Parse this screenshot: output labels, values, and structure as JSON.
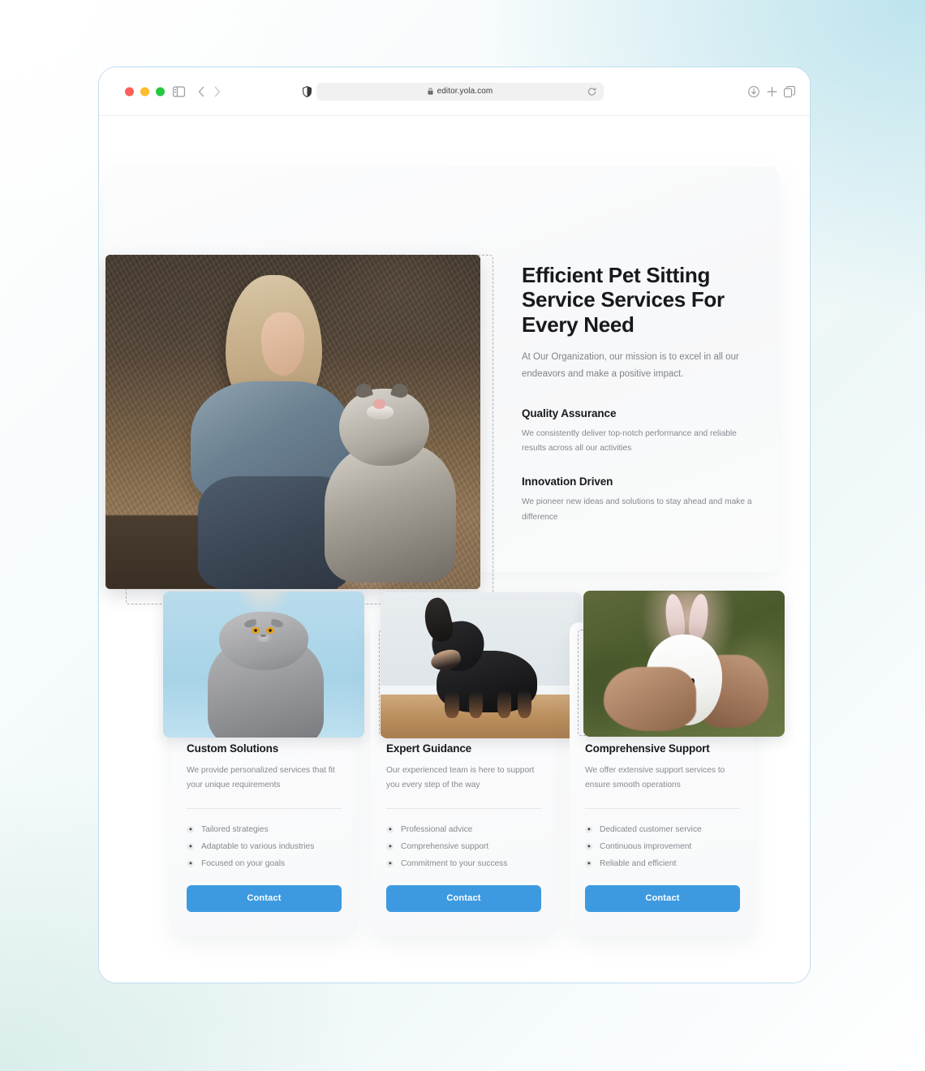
{
  "browser": {
    "url": "editor.yola.com",
    "lock_icon": "lock-icon",
    "reload_icon": "reload-icon",
    "sidebar_icon": "sidebar-toggle-icon",
    "back_icon": "back-chevron-icon",
    "forward_icon": "forward-chevron-icon",
    "shield_icon": "privacy-shield-icon",
    "download_icon": "download-icon",
    "new_tab_icon": "plus-icon",
    "tabs_icon": "tab-overview-icon",
    "traffic_lights": [
      "close",
      "minimize",
      "maximize"
    ]
  },
  "hero": {
    "title": "Efficient Pet Sitting Service Services For Every Need",
    "subtitle": "At Our Organization, our mission is to excel in all our endeavors and make a positive impact.",
    "image_alt": "woman-sitting-with-dog-photo",
    "features": [
      {
        "title": "Quality Assurance",
        "body": "We consistently deliver top-notch performance and reliable results across all our activities"
      },
      {
        "title": "Innovation Driven",
        "body": "We pioneer new ideas and solutions to stay ahead and make a difference"
      }
    ]
  },
  "cards": [
    {
      "image_alt": "grey-cat-photo",
      "title": "Custom Solutions",
      "description": "We provide personalized services that fit your unique requirements",
      "items": [
        "Tailored strategies",
        "Adaptable to various industries",
        "Focused on your goals"
      ],
      "button": "Contact"
    },
    {
      "image_alt": "black-dachshund-photo",
      "title": "Expert Guidance",
      "description": "Our experienced team is here to support you every step of the way",
      "items": [
        "Professional advice",
        "Comprehensive support",
        "Commitment to your success"
      ],
      "button": "Contact"
    },
    {
      "image_alt": "white-rabbit-photo",
      "title": "Comprehensive Support",
      "description": "We offer extensive support services to ensure smooth operations",
      "items": [
        "Dedicated customer service",
        "Continuous improvement",
        "Reliable and efficient"
      ],
      "button": "Contact"
    }
  ],
  "colors": {
    "accent": "#3d9ae0",
    "heading": "#17191c",
    "body_text": "#85898f",
    "selection_outline": "#b2b2b2",
    "window_border": "#bedcf0"
  }
}
